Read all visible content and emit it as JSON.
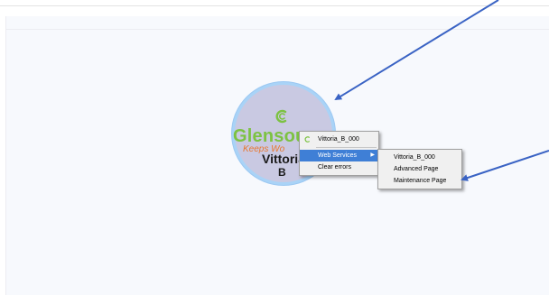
{
  "device_node": {
    "logo_text": "Glensou",
    "tagline": "Keeps Wo",
    "name_line1": "Vittoria",
    "name_line2": "B",
    "fill_color": "#c9c9e2",
    "ring_color": "#a9d3f7"
  },
  "context_menu": {
    "header": "Vittoria_B_000",
    "header_icon": "glensound-logo-icon",
    "items": [
      {
        "label": "Web Services",
        "has_submenu": true,
        "highlighted": true
      },
      {
        "label": "Clear errors",
        "has_submenu": false,
        "highlighted": false
      }
    ]
  },
  "sub_menu": {
    "items": [
      {
        "label": "Vittoria_B_000"
      },
      {
        "label": "Advanced Page"
      },
      {
        "label": "Maintenance Page"
      }
    ]
  },
  "colors": {
    "highlight": "#3f7fd6",
    "arrow": "#3a63c4",
    "logo_green": "#7cc242",
    "logo_orange": "#e8772e"
  }
}
